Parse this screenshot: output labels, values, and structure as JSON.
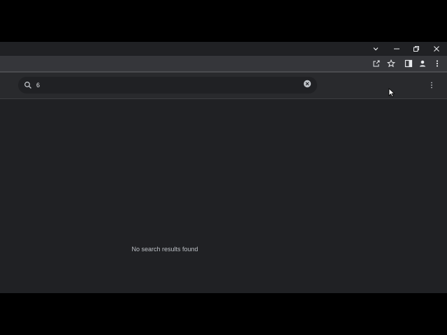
{
  "search": {
    "value": "6",
    "placeholder": ""
  },
  "main": {
    "empty_message": "No search results found"
  },
  "colors": {
    "window_bg": "#202124",
    "toolbar_bg": "#35363a",
    "header_bg": "#292a2d",
    "text": "#e8eaed",
    "muted_text": "#bdc1c6"
  },
  "icons": {
    "tab_search": "chevron-down-icon",
    "minimize": "minimize-icon",
    "restore": "restore-icon",
    "close": "close-icon",
    "share": "share-icon",
    "bookmark": "star-icon",
    "side_panel": "side-panel-icon",
    "profile": "profile-icon",
    "browser_menu": "kebab-menu-icon",
    "search": "search-icon",
    "clear": "clear-icon",
    "page_menu": "more-vertical-icon"
  }
}
